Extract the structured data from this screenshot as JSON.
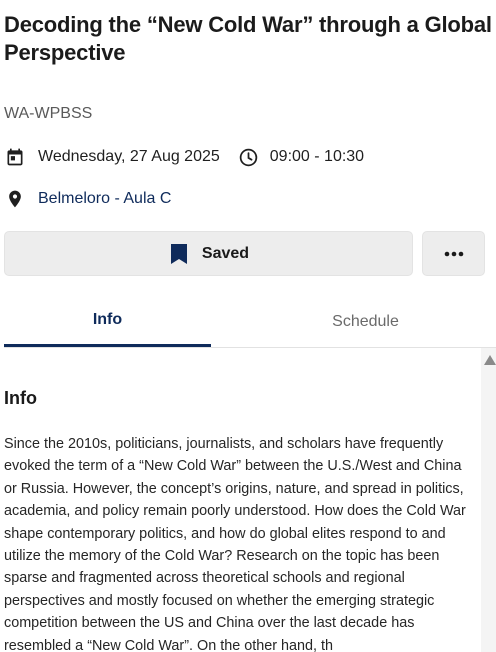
{
  "event": {
    "title": "Decoding the “New Cold War” through a Global Perspective",
    "code": "WA-WPBSS",
    "date": "Wednesday, 27 Aug 2025",
    "time": "09:00 - 10:30",
    "location": "Belmeloro - Aula C"
  },
  "actions": {
    "saved_label": "Saved"
  },
  "tabs": [
    {
      "label": "Info",
      "active": true
    },
    {
      "label": "Schedule",
      "active": false
    }
  ],
  "info": {
    "heading": "Info",
    "description": "Since the 2010s, politicians, journalists, and scholars have frequently evoked the term of a “New Cold War” between the U.S./West and China or Russia. However, the concept’s origins, nature, and spread in politics, academia, and policy remain poorly understood. How does the Cold War shape contemporary politics, and how do global elites respond to and utilize the memory of the Cold War? Research on the topic has been sparse and fragmented across theoretical schools and regional perspectives and mostly focused on whether the emerging strategic competition between the US and China over the last decade has resembled a “New Cold War”. On the other hand, th"
  },
  "icons": {
    "calendar": "calendar-icon",
    "clock": "clock-icon",
    "location": "location-pin-icon",
    "bookmark": "bookmark-icon",
    "more": "more-horizontal-icon",
    "scroll_up": "scroll-up-arrow-icon"
  },
  "colors": {
    "accent": "#0f2b5b",
    "button_bg": "#ededed",
    "muted_text": "#5a5a5a"
  }
}
